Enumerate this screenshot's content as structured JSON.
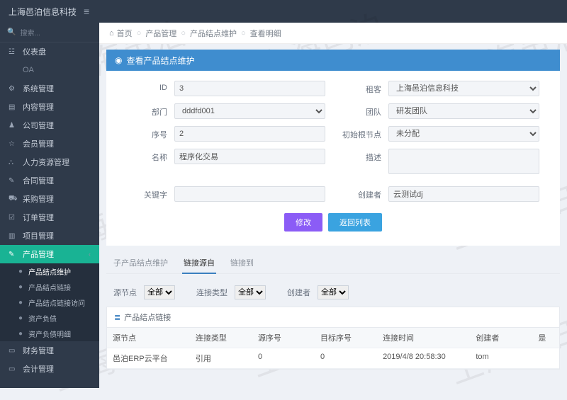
{
  "brand": "上海邑泊信息科技",
  "searchPlaceholder": "搜索...",
  "sidebar": {
    "items": [
      {
        "icon": "☳",
        "label": "仪表盘"
      },
      {
        "icon": "",
        "label": "OA",
        "dim": true
      },
      {
        "icon": "⚙",
        "label": "系统管理"
      },
      {
        "icon": "▤",
        "label": "内容管理"
      },
      {
        "icon": "♟",
        "label": "公司管理"
      },
      {
        "icon": "☆",
        "label": "会员管理"
      },
      {
        "icon": "⛬",
        "label": "人力资源管理"
      },
      {
        "icon": "✎",
        "label": "合同管理"
      },
      {
        "icon": "⛟",
        "label": "采购管理"
      },
      {
        "icon": "☑",
        "label": "订单管理"
      },
      {
        "icon": "▥",
        "label": "项目管理"
      },
      {
        "icon": "✎",
        "label": "产品管理",
        "active": true
      },
      {
        "icon": "▭",
        "label": "财务管理"
      },
      {
        "icon": "▭",
        "label": "会计管理"
      }
    ],
    "sub": [
      {
        "label": "产品结点维护",
        "on": true
      },
      {
        "label": "产品结点链接"
      },
      {
        "label": "产品结点链接访问"
      },
      {
        "label": "资产负债"
      },
      {
        "label": "资产负债明细"
      }
    ]
  },
  "breadcrumb": {
    "home": "首页",
    "a": "产品管理",
    "b": "产品结点维护",
    "c": "查看明细"
  },
  "panelTitle": "查看产品结点维护",
  "form": {
    "id_label": "ID",
    "id_value": "3",
    "tenant_label": "租客",
    "tenant_value": "上海邑泊信息科技",
    "dept_label": "部门",
    "dept_value": "dddfd001",
    "team_label": "团队",
    "team_value": "研发团队",
    "seq_label": "序号",
    "seq_value": "2",
    "rootnode_label": "初始根节点",
    "rootnode_value": "未分配",
    "name_label": "名称",
    "name_value": "程序化交易",
    "desc_label": "描述",
    "desc_value": "",
    "keyword_label": "关键字",
    "keyword_value": "",
    "creator_label": "创建者",
    "creator_value": "云测试dj"
  },
  "buttons": {
    "edit": "修改",
    "back": "返回列表"
  },
  "tabs": {
    "a": "子产品结点维护",
    "b": "链接源自",
    "c": "链接到"
  },
  "filters": {
    "src_label": "源节点",
    "src_value": "全部",
    "type_label": "连接类型",
    "type_value": "全部",
    "creator_label": "创建者",
    "creator_value": "全部"
  },
  "subhead": "产品结点链接",
  "table": {
    "headers": [
      "源节点",
      "连接类型",
      "源序号",
      "目标序号",
      "连接时间",
      "创建者",
      "是"
    ],
    "rows": [
      [
        "邑泊ERP云平台",
        "引用",
        "0",
        "0",
        "2019/4/8 20:58:30",
        "tom",
        ""
      ]
    ]
  },
  "watermark": "上海邑泊"
}
